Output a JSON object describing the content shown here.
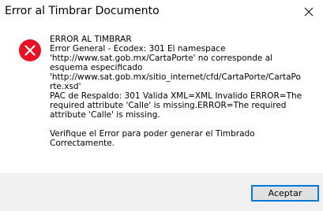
{
  "window": {
    "title": "Error al Timbrar Documento",
    "close_icon": "close-icon"
  },
  "message": {
    "icon": "error-icon",
    "icon_color": "#e81123",
    "lines": [
      "ERROR AL TIMBRAR",
      "Error General - Ecodex: 301 El namespace",
      "'http://www.sat.gob.mx/CartaPorte' no corresponde al",
      "esquema especificado",
      "'http://www.sat.gob.mx/sitio_internet/cfd/CartaPorte/CartaPo",
      "rte.xsd'",
      "PAC de Respaldo: 301  Valida XML=XML Invalido ERROR=The",
      "required attribute 'Calle' is missing.ERROR=The required",
      "attribute 'Calle' is missing."
    ],
    "footer_lines": [
      "Verifique el Error para poder generar el Timbrado",
      "Correctamente."
    ]
  },
  "buttons": {
    "accept_label": "Aceptar"
  },
  "colors": {
    "footer_bg": "#f0f0f0",
    "button_border": "#0078d7"
  }
}
